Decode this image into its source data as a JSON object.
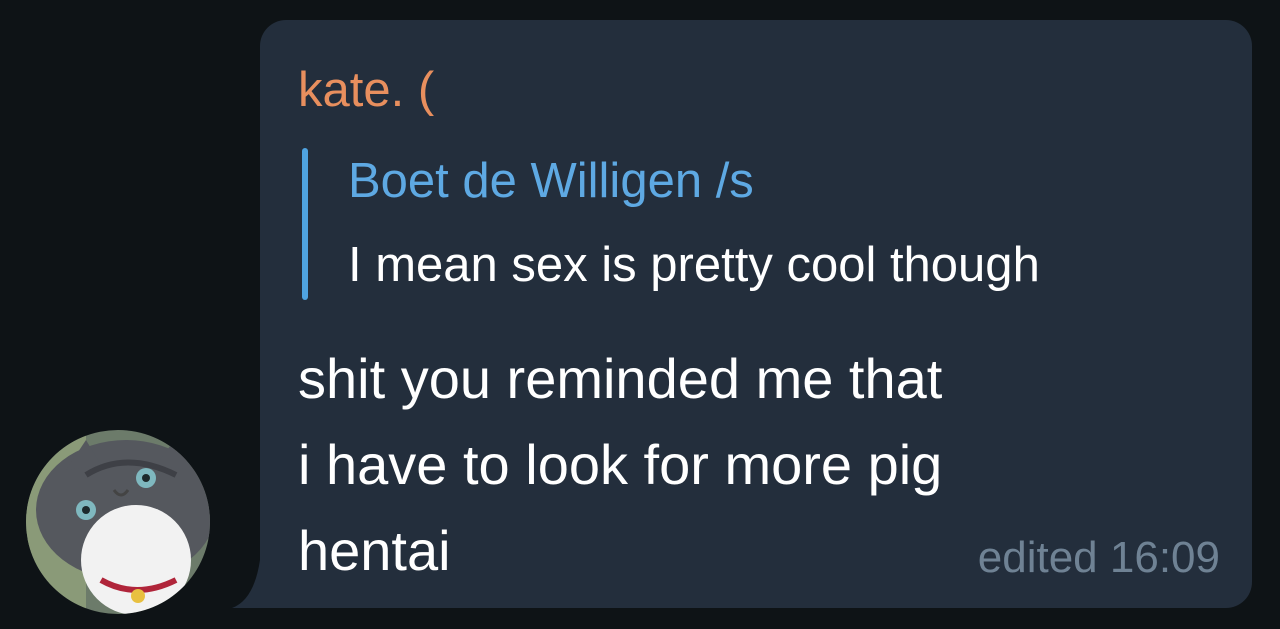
{
  "message": {
    "sender_name": "kate. (",
    "reply": {
      "author": "Boet de Willigen /s",
      "text": "I mean sex is pretty cool though"
    },
    "body_lines": [
      "shit you reminded me that",
      "i have to look for more pig",
      "hentai"
    ],
    "edited_label": "edited",
    "time": "16:09"
  },
  "colors": {
    "background": "#0e1316",
    "bubble": "#232e3c",
    "sender": "#e88f5e",
    "reply_accent": "#4fa3e0",
    "meta": "#6f8294"
  },
  "avatar": {
    "icon": "cat-avatar-icon"
  }
}
